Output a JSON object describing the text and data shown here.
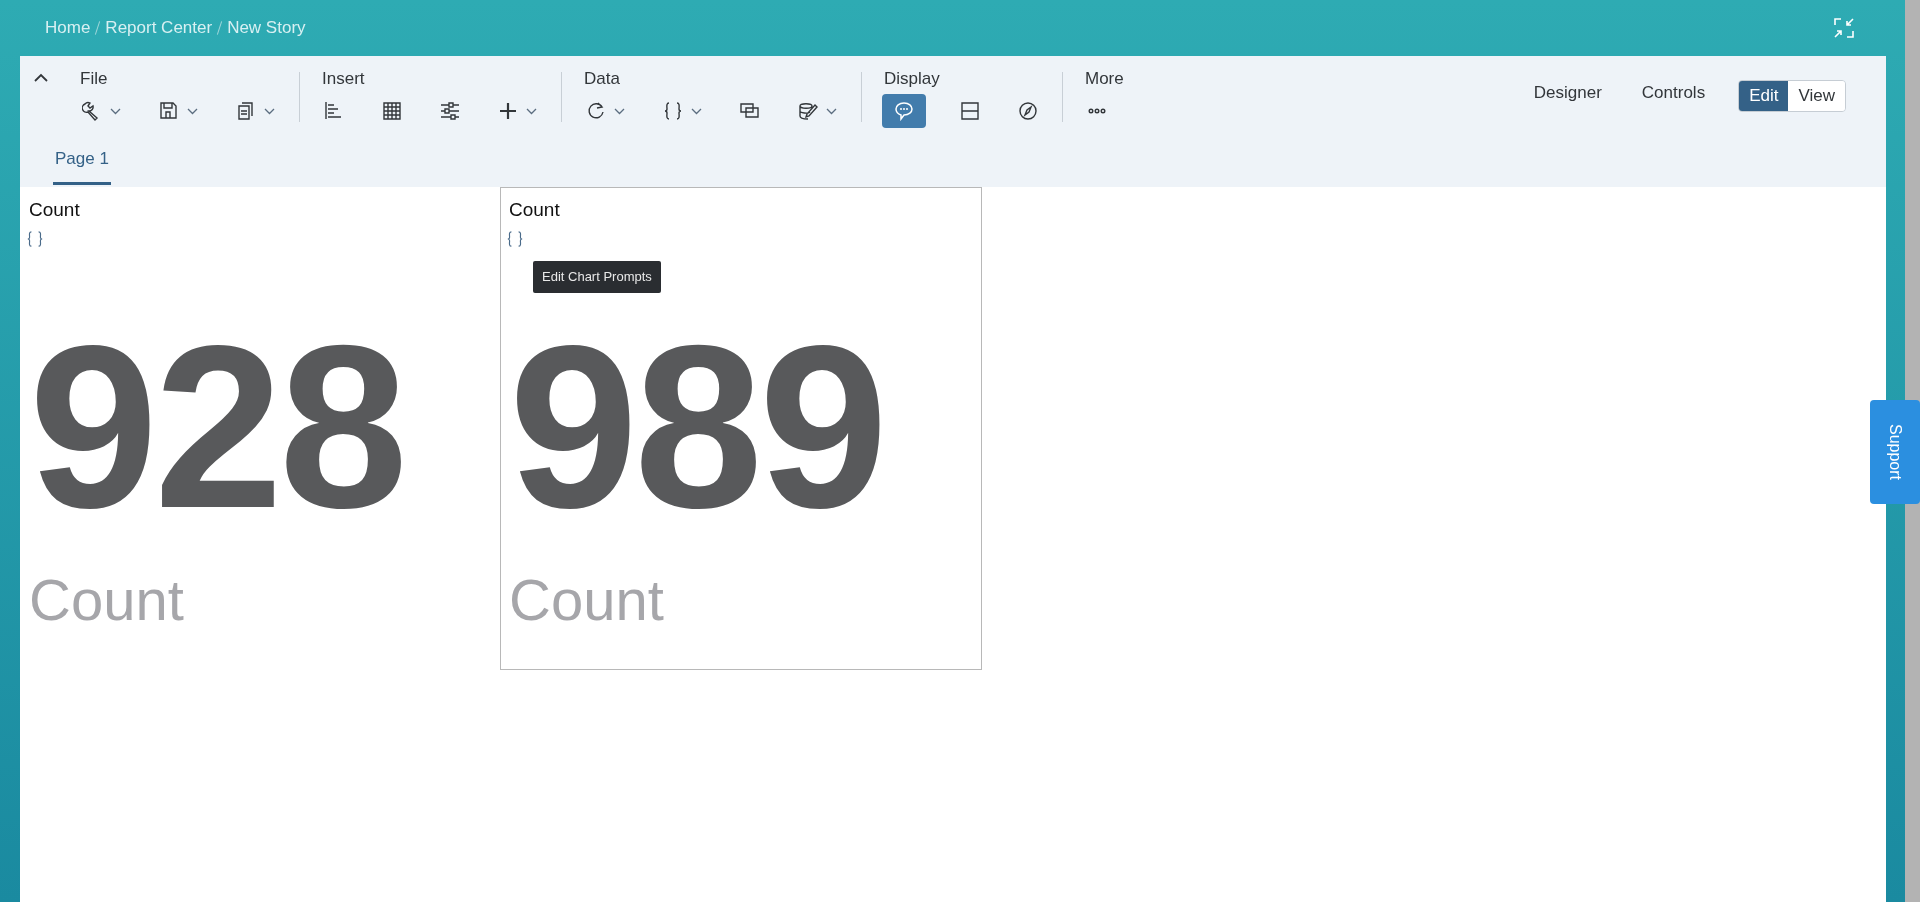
{
  "breadcrumbs": [
    "Home",
    "Report Center",
    "New Story"
  ],
  "toolbar": {
    "groups": [
      {
        "label": "File",
        "items": [
          {
            "kind": "wrench",
            "dropdown": true,
            "selected": false
          },
          {
            "kind": "save",
            "dropdown": true,
            "selected": false
          },
          {
            "kind": "copy",
            "dropdown": true,
            "selected": false
          }
        ]
      },
      {
        "label": "Insert",
        "items": [
          {
            "kind": "barchart",
            "dropdown": false,
            "selected": false
          },
          {
            "kind": "table",
            "dropdown": false,
            "selected": false
          },
          {
            "kind": "sliders",
            "dropdown": false,
            "selected": false
          },
          {
            "kind": "plus",
            "dropdown": true,
            "selected": false
          }
        ]
      },
      {
        "label": "Data",
        "items": [
          {
            "kind": "refresh",
            "dropdown": true,
            "selected": false
          },
          {
            "kind": "braces",
            "dropdown": true,
            "selected": false
          },
          {
            "kind": "layers",
            "dropdown": false,
            "selected": false
          },
          {
            "kind": "dbedit",
            "dropdown": true,
            "selected": false
          }
        ]
      },
      {
        "label": "Display",
        "items": [
          {
            "kind": "comment",
            "dropdown": false,
            "selected": true
          },
          {
            "kind": "split",
            "dropdown": false,
            "selected": false
          },
          {
            "kind": "compass",
            "dropdown": false,
            "selected": false
          }
        ]
      },
      {
        "label": "More",
        "items": [
          {
            "kind": "dots",
            "dropdown": false,
            "selected": false
          }
        ]
      }
    ],
    "links": [
      "Designer",
      "Controls"
    ],
    "modes": [
      {
        "label": "Edit",
        "selected": true
      },
      {
        "label": "View",
        "selected": false
      }
    ]
  },
  "pages": [
    {
      "label": "Page 1",
      "selected": true
    }
  ],
  "tiles": [
    {
      "title": "Count",
      "value": "928",
      "caption": "Count",
      "selected": false
    },
    {
      "title": "Count",
      "value": "989",
      "caption": "Count",
      "selected": true
    }
  ],
  "tooltip": "Edit Chart Prompts",
  "support": "Support"
}
